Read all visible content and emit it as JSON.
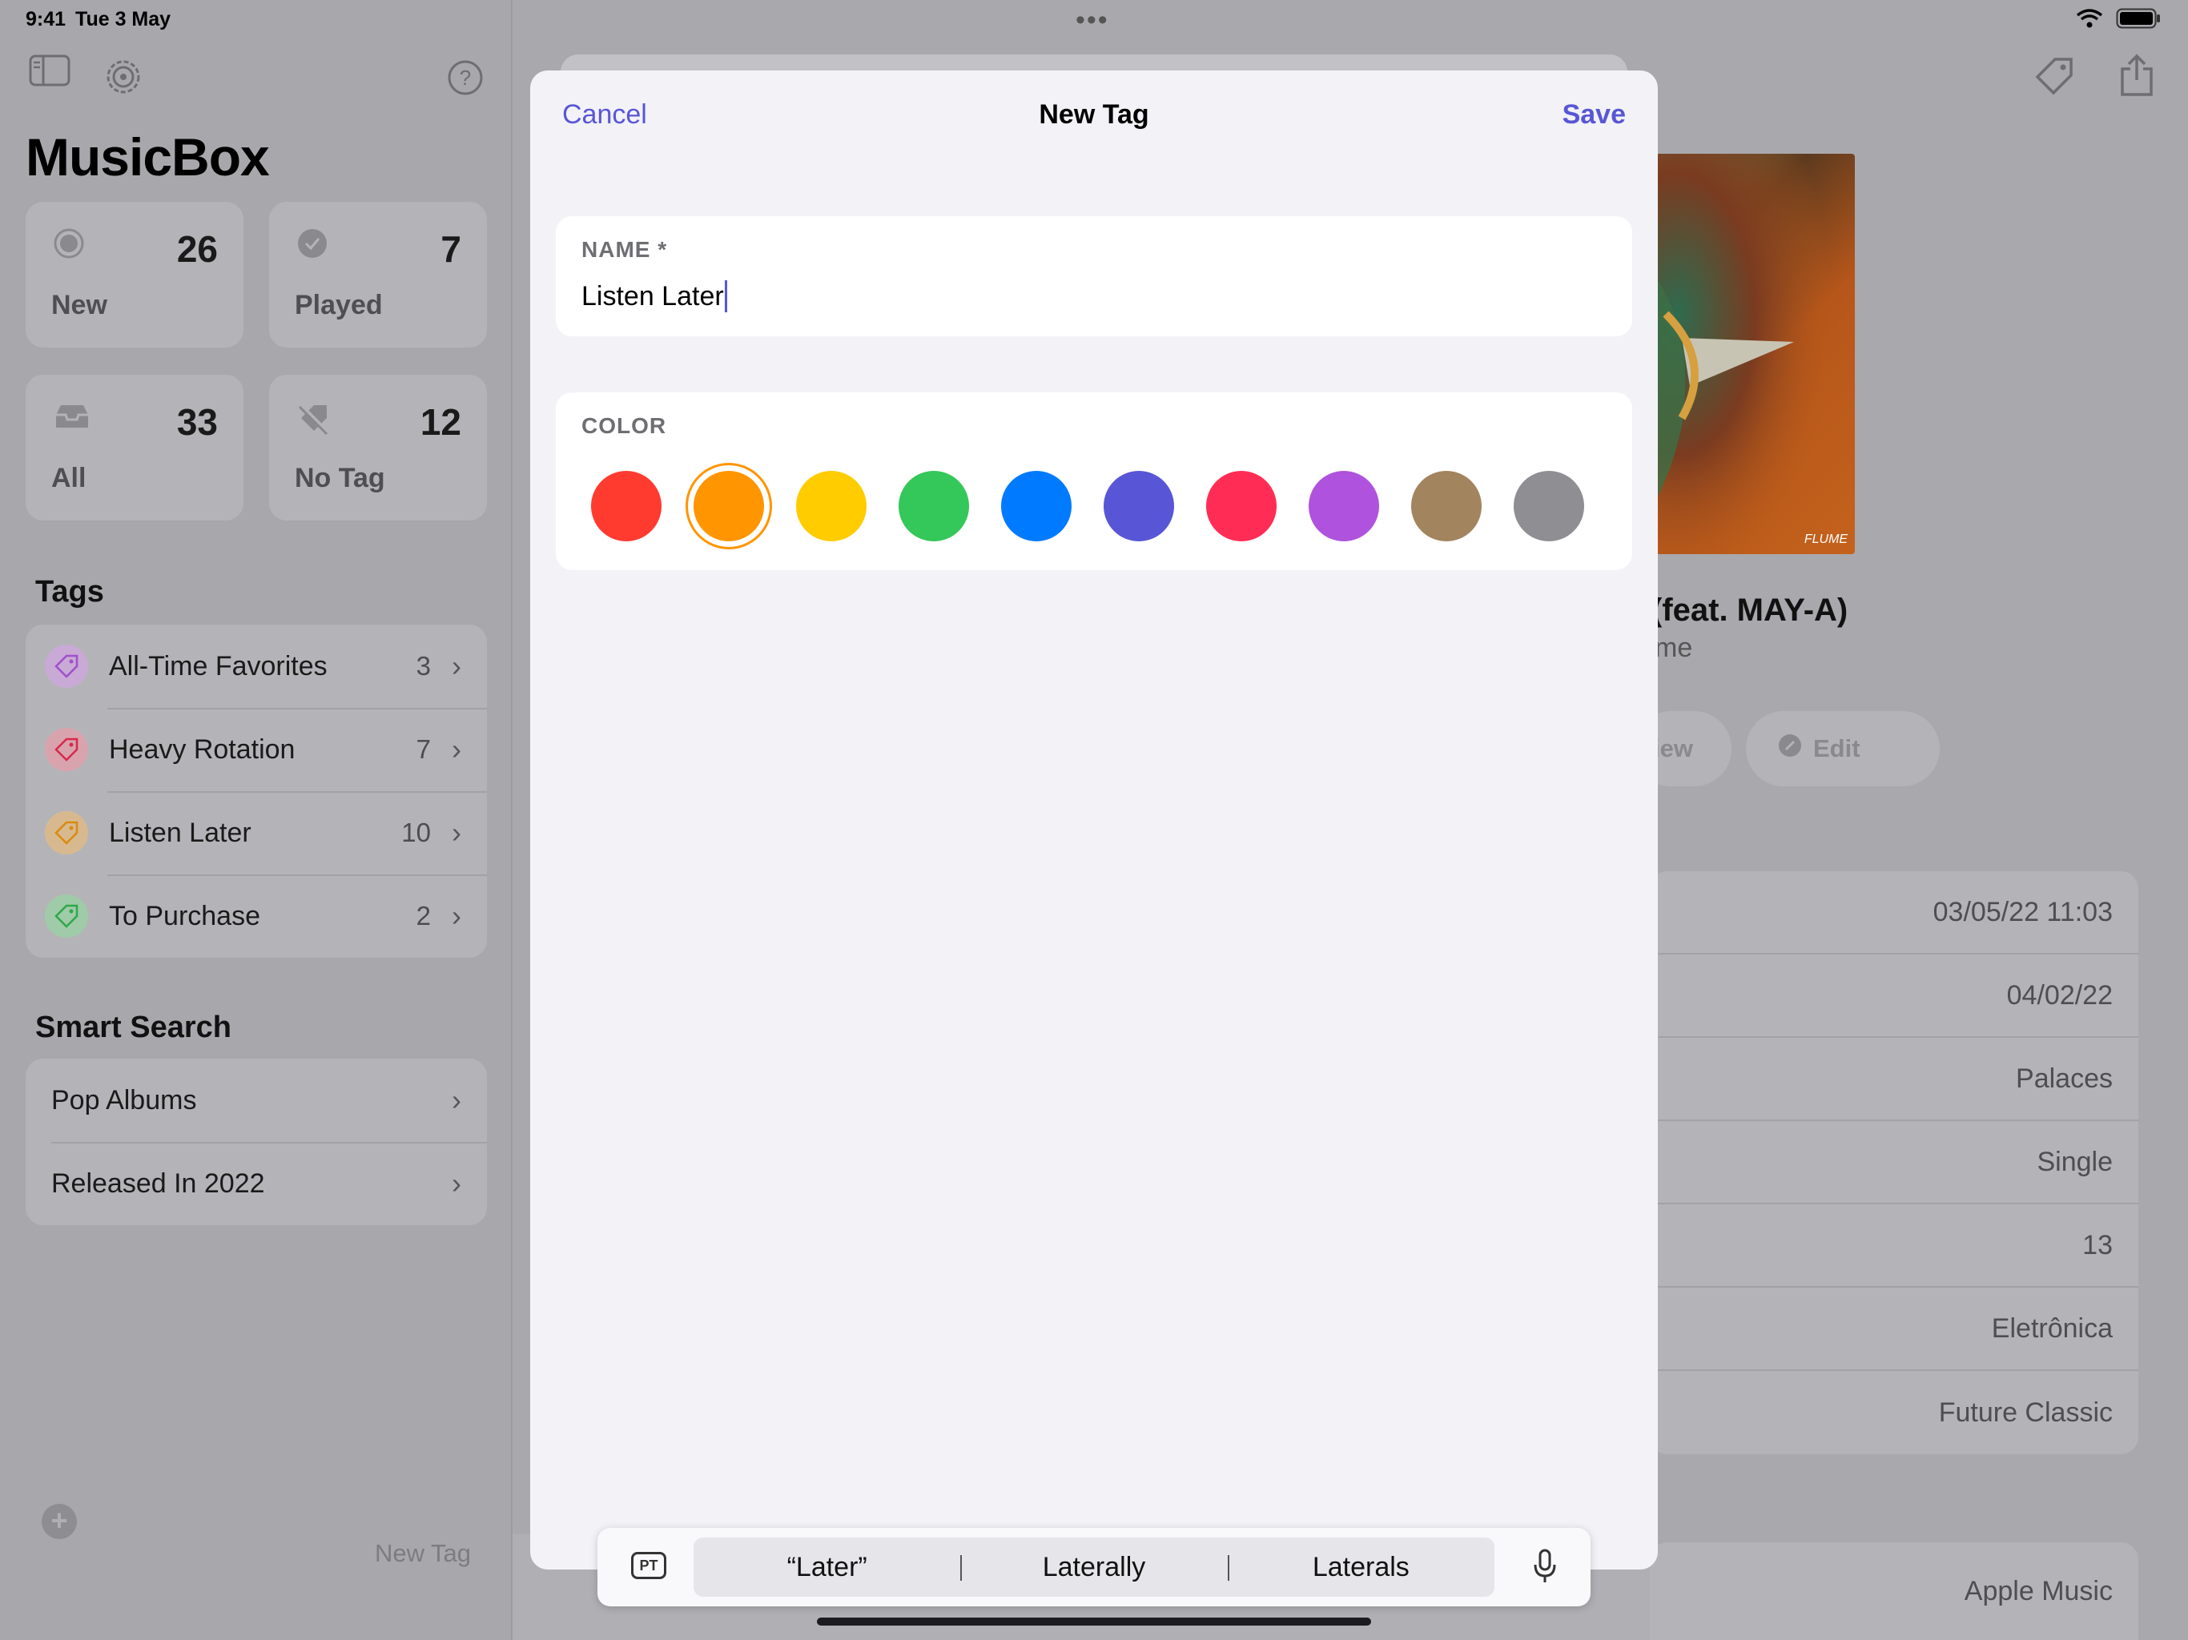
{
  "status": {
    "time": "9:41",
    "date": "Tue 3 May"
  },
  "sidebar": {
    "title": "MusicBox",
    "stats": [
      {
        "label": "New",
        "count": "26"
      },
      {
        "label": "Played",
        "count": "7"
      },
      {
        "label": "All",
        "count": "33"
      },
      {
        "label": "No Tag",
        "count": "12"
      }
    ],
    "tags_title": "Tags",
    "tags": [
      {
        "name": "All-Time Favorites",
        "count": "3",
        "color": "#af52de"
      },
      {
        "name": "Heavy Rotation",
        "count": "7",
        "color": "#ff2d55"
      },
      {
        "name": "Listen Later",
        "count": "10",
        "color": "#ff9500"
      },
      {
        "name": "To Purchase",
        "count": "2",
        "color": "#34c759"
      }
    ],
    "smart_search_title": "Smart Search",
    "smart_searches": [
      {
        "name": "Pop Albums"
      },
      {
        "name": "Released In 2022"
      }
    ],
    "footer_label": "New Tag"
  },
  "detail": {
    "song_title": "(feat. MAY-A)",
    "song_artist": "me",
    "artwork_mark": "FLUME",
    "view_label": "iew",
    "edit_label": "Edit",
    "rows": [
      "03/05/22 11:03",
      "04/02/22",
      "Palaces",
      "Single",
      "13",
      "Eletrônica",
      "Future Classic"
    ],
    "bottom_row": "Apple Music"
  },
  "sheet": {
    "cancel": "Cancel",
    "title": "New Tag",
    "save": "Save",
    "name_label": "NAME *",
    "name_value": "Listen Later",
    "color_label": "COLOR",
    "colors": [
      "#ff3b30",
      "#ff9500",
      "#ffcc00",
      "#34c759",
      "#007aff",
      "#5856d6",
      "#ff2d55",
      "#af52de",
      "#a2845e",
      "#8e8e93"
    ],
    "selected_color": "#ff9500"
  },
  "keyboard": {
    "lang": "PT",
    "suggestions": [
      "“Later”",
      "Laterally",
      "Laterals"
    ]
  }
}
